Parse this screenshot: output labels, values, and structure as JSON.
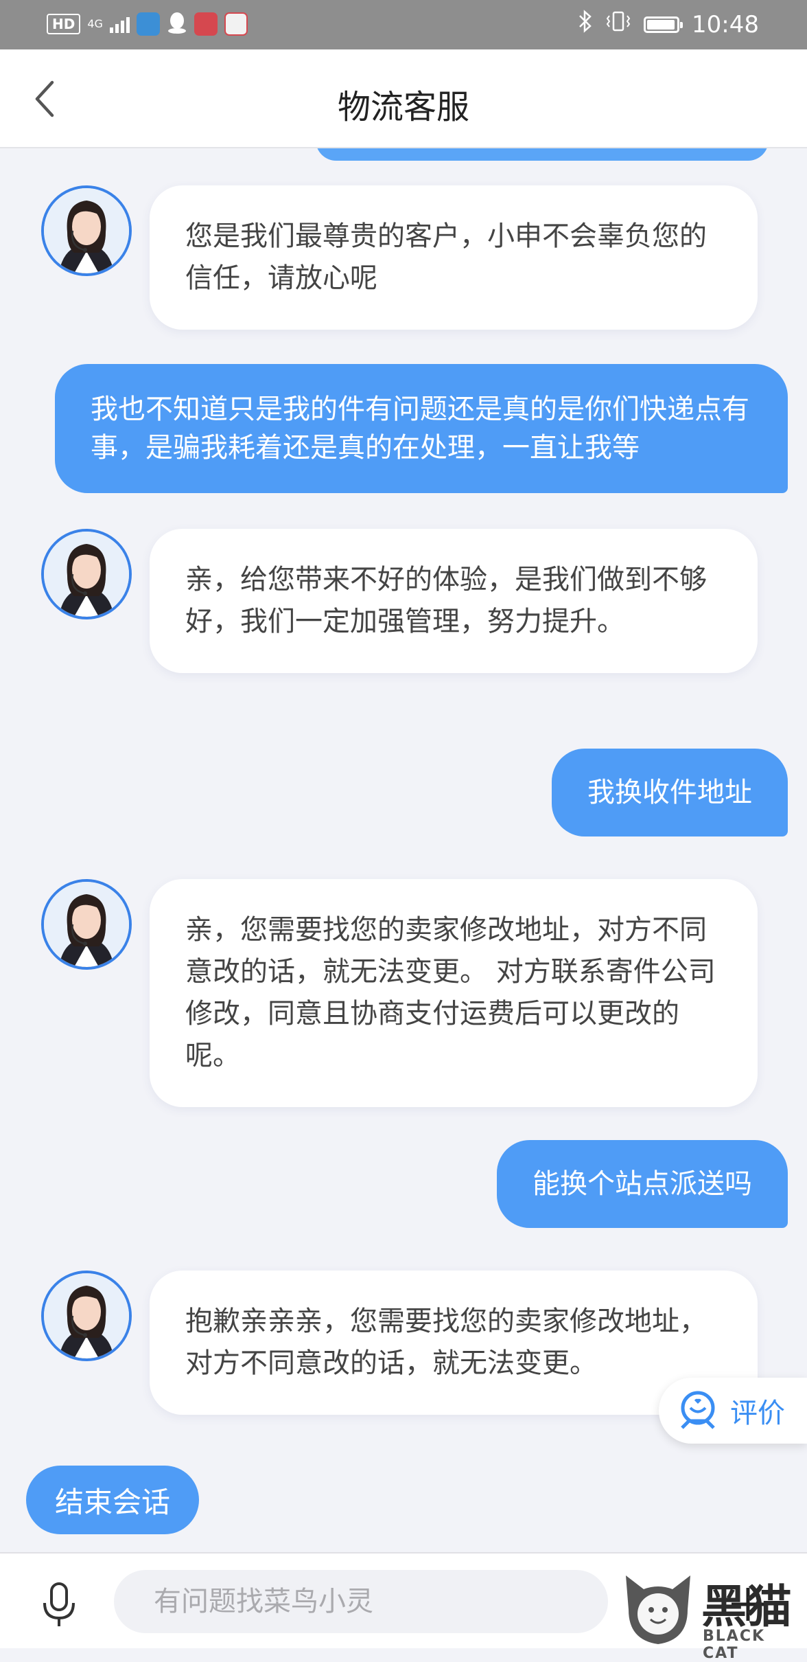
{
  "status_bar": {
    "badge": "HD",
    "network": "4G",
    "time": "10:48",
    "battery_level": 0.9
  },
  "header": {
    "title": "物流客服"
  },
  "messages": [
    {
      "from": "agent",
      "text": "您是我们最尊贵的客户，小申不会辜负您的信任，请放心呢"
    },
    {
      "from": "user",
      "text": "我也不知道只是我的件有问题还是真的是你们快递点有事，是骗我耗着还是真的在处理，一直让我等"
    },
    {
      "from": "agent",
      "text": "亲，给您带来不好的体验，是我们做到不够好，我们一定加强管理，努力提升。"
    },
    {
      "from": "user",
      "text": "我换收件地址"
    },
    {
      "from": "agent",
      "text": "亲，您需要找您的卖家修改地址，对方不同意改的话，就无法变更。 对方联系寄件公司修改，同意且协商支付运费后可以更改的呢。"
    },
    {
      "from": "user",
      "text": "能换个站点派送吗"
    },
    {
      "from": "agent",
      "text": "抱歉亲亲亲，您需要找您的卖家修改地址，对方不同意改的话，就无法变更。"
    }
  ],
  "review_button": {
    "label": "评价"
  },
  "end_session_button": {
    "label": "结束会话"
  },
  "input": {
    "placeholder": "有问题找菜鸟小灵"
  },
  "watermark": {
    "brand": "黑猫",
    "sub": "BLACK CAT"
  },
  "colors": {
    "accent": "#4f9cf6",
    "background": "#f2f3f8",
    "avatar_border": "#3a82e8"
  }
}
